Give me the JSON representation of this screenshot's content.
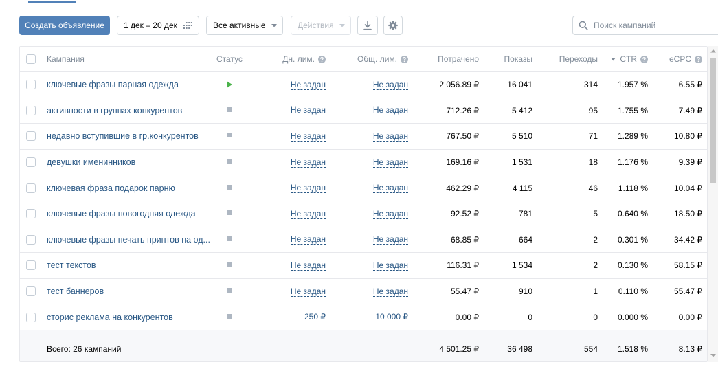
{
  "toolbar": {
    "create_label": "Создать объявление",
    "date_range": "1 дек – 20 дек",
    "filter_label": "Все активные",
    "actions_label": "Действия",
    "actions_disabled": true,
    "search_placeholder": "Поиск кампаний"
  },
  "icons": {
    "date_range": "calendar-grid-icon",
    "dropdown": "chevron-down-icon",
    "download": "download-icon",
    "settings": "gear-icon",
    "search": "search-icon",
    "help": "help-icon",
    "ctr_sort": "sort-desc-icon",
    "status_running": "play-icon",
    "status_stopped": "stop-icon"
  },
  "table": {
    "headers": {
      "campaign": "Кампания",
      "status": "Статус",
      "daily_limit": "Дн. лим.",
      "total_limit": "Общ. лим.",
      "spent": "Потрачено",
      "impressions": "Показы",
      "clicks": "Переходы",
      "ctr": "CTR",
      "ecpc": "eCPC"
    },
    "rows": [
      {
        "name": "ключевые фразы парная одежда",
        "status_icon": "play-icon",
        "daily_limit": "Не задан",
        "total_limit": "Не задан",
        "spent": "2 056.89 ₽",
        "impressions": "16 041",
        "clicks": "314",
        "ctr": "1.957 %",
        "ecpc": "6.55 ₽"
      },
      {
        "name": "активности в группах конкурентов",
        "status_icon": "stop-icon",
        "daily_limit": "Не задан",
        "total_limit": "Не задан",
        "spent": "712.26 ₽",
        "impressions": "5 412",
        "clicks": "95",
        "ctr": "1.755 %",
        "ecpc": "7.49 ₽"
      },
      {
        "name": "недавно вступившие в гр.конкурентов",
        "status_icon": "stop-icon",
        "daily_limit": "Не задан",
        "total_limit": "Не задан",
        "spent": "767.50 ₽",
        "impressions": "5 510",
        "clicks": "71",
        "ctr": "1.289 %",
        "ecpc": "10.80 ₽"
      },
      {
        "name": "девушки именинников",
        "status_icon": "stop-icon",
        "daily_limit": "Не задан",
        "total_limit": "Не задан",
        "spent": "169.16 ₽",
        "impressions": "1 531",
        "clicks": "18",
        "ctr": "1.176 %",
        "ecpc": "9.39 ₽"
      },
      {
        "name": "ключевая фраза подарок парню",
        "status_icon": "stop-icon",
        "daily_limit": "Не задан",
        "total_limit": "Не задан",
        "spent": "462.29 ₽",
        "impressions": "4 115",
        "clicks": "46",
        "ctr": "1.118 %",
        "ecpc": "10.04 ₽"
      },
      {
        "name": "ключевые фразы новогодняя одежда",
        "status_icon": "stop-icon",
        "daily_limit": "Не задан",
        "total_limit": "Не задан",
        "spent": "92.52 ₽",
        "impressions": "781",
        "clicks": "5",
        "ctr": "0.640 %",
        "ecpc": "18.50 ₽"
      },
      {
        "name": "ключевые фразы печать принтов на од...",
        "status_icon": "stop-icon",
        "daily_limit": "Не задан",
        "total_limit": "Не задан",
        "spent": "68.85 ₽",
        "impressions": "664",
        "clicks": "2",
        "ctr": "0.301 %",
        "ecpc": "34.42 ₽"
      },
      {
        "name": "тест текстов",
        "status_icon": "stop-icon",
        "daily_limit": "Не задан",
        "total_limit": "Не задан",
        "spent": "116.31 ₽",
        "impressions": "1 534",
        "clicks": "2",
        "ctr": "0.130 %",
        "ecpc": "58.15 ₽"
      },
      {
        "name": "тест баннеров",
        "status_icon": "stop-icon",
        "daily_limit": "Не задан",
        "total_limit": "Не задан",
        "spent": "55.47 ₽",
        "impressions": "910",
        "clicks": "1",
        "ctr": "0.110 %",
        "ecpc": "55.47 ₽"
      },
      {
        "name": "сторис реклама на конкурентов",
        "status_icon": "stop-icon",
        "daily_limit": "250 ₽",
        "total_limit": "10 000 ₽",
        "spent": "0.00 ₽",
        "impressions": "0",
        "clicks": "0",
        "ctr": "0.000 %",
        "ecpc": "0.00 ₽"
      }
    ],
    "totals": {
      "label": "Всего: 26 кампаний",
      "spent": "4 501.25 ₽",
      "impressions": "36 498",
      "clicks": "554",
      "ctr": "1.518 %",
      "ecpc": "8.13 ₽"
    }
  },
  "colors": {
    "accent": "#5181b8",
    "link": "#2a5885",
    "status_running": "#4bb34b",
    "status_stopped": "#aeb7c2"
  }
}
